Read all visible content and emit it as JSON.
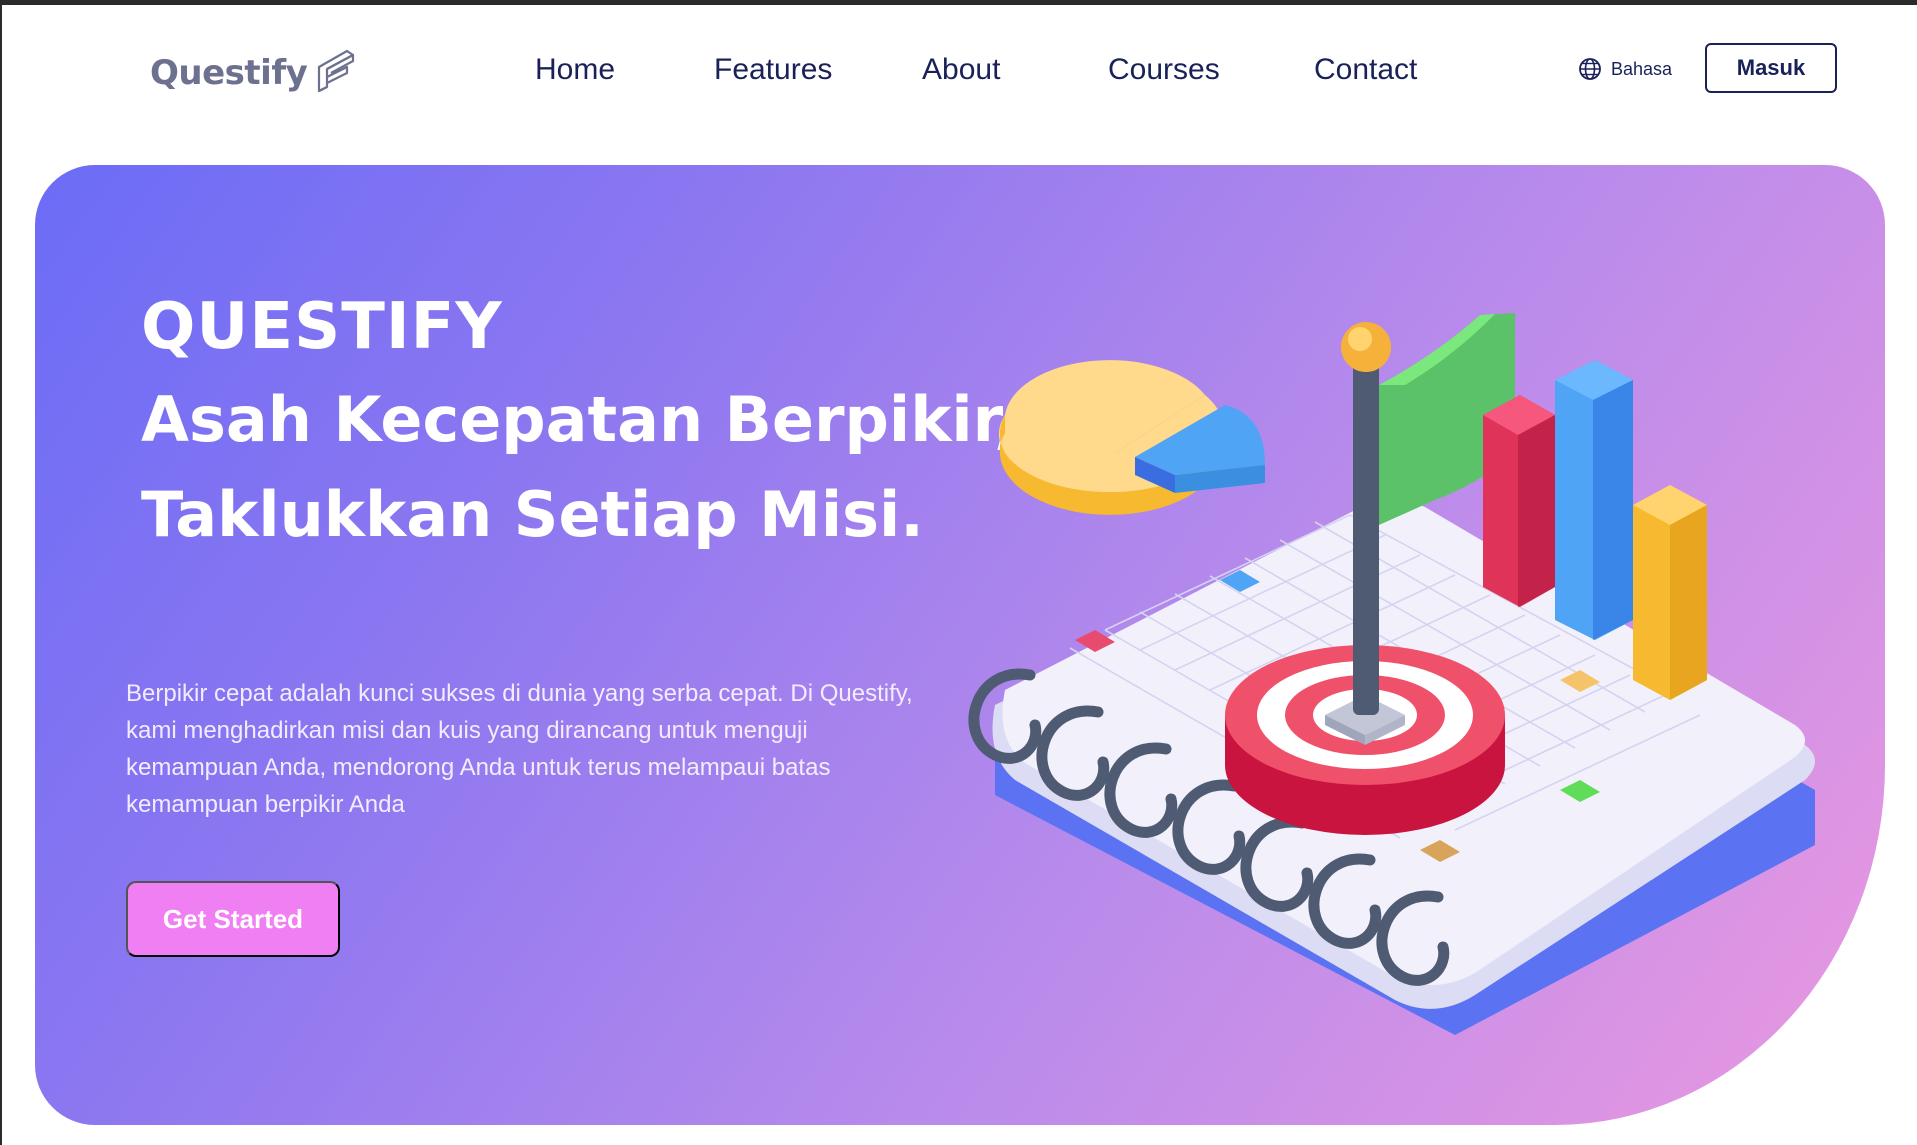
{
  "brand": {
    "name": "Questify",
    "logo_icon": "folded-paper-q-icon",
    "text_color": "#6d7190"
  },
  "nav": {
    "links": [
      "Home",
      "Features",
      "About",
      "Courses",
      "Contact"
    ],
    "language": {
      "label": "Bahasa",
      "icon": "globe-icon"
    },
    "login_label": "Masuk",
    "text_color": "#1a2158"
  },
  "hero": {
    "eyebrow": "QUESTIFY",
    "title_line_1": "Asah Kecepatan Berpikir,",
    "title_line_2": "Taklukkan Setiap Misi.",
    "description": "Berpikir cepat adalah kunci sukses di dunia yang serba cepat. Di Questify, kami menghadirkan misi dan kuis yang dirancang untuk menguji kemampuan Anda, mendorong Anda untuk terus melampaui batas kemampuan berpikir Anda",
    "cta_label": "Get Started",
    "gradient": [
      "#6b6cf6",
      "#8f78f0",
      "#b98beb",
      "#ea98e0"
    ],
    "cta_color": "#f07ff4",
    "illustration": "isometric-notebook-target-flag-charts"
  }
}
